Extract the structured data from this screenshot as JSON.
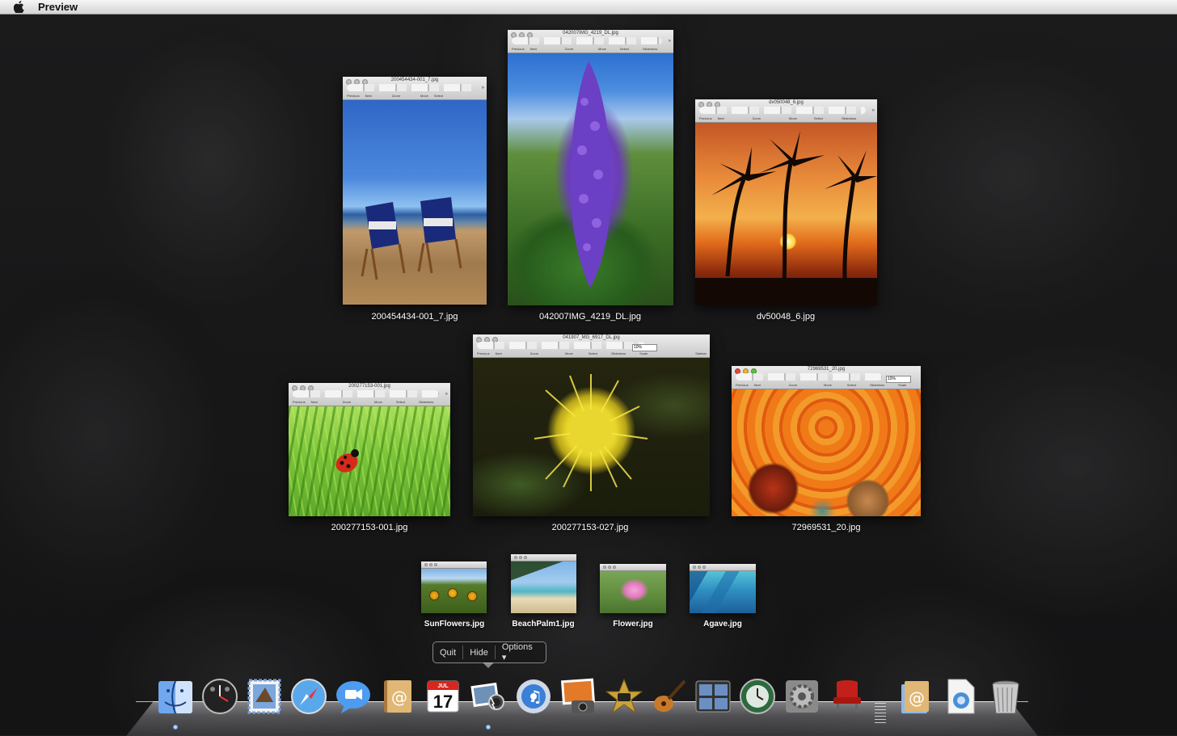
{
  "menubar": {
    "app_name": "Preview"
  },
  "windows": [
    {
      "title": "200454434-001_7.jpg",
      "caption": "200454434-001_7.jpg",
      "toolbar": [
        "Previous",
        "Next",
        "Zoom",
        "Move",
        "Select"
      ]
    },
    {
      "title": "042007IMG_4219_DL.jpg",
      "caption": "042007IMG_4219_DL.jpg",
      "toolbar": [
        "Previous",
        "Next",
        "Zoom",
        "Move",
        "Select",
        "Slideshow"
      ]
    },
    {
      "title": "dv050048_6.jpg",
      "caption": "dv50048_6.jpg",
      "toolbar": [
        "Previous",
        "Next",
        "Zoom",
        "Move",
        "Select",
        "Slideshow"
      ]
    },
    {
      "title": "200277153-001.jpg",
      "caption": "200277153-001.jpg",
      "toolbar": [
        "Previous",
        "Next",
        "Zoom",
        "Move",
        "Select",
        "Slideshow"
      ]
    },
    {
      "title": "041907_MG_6917_DL.jpg",
      "caption": "200277153-027.jpg",
      "toolbar": [
        "Previous",
        "Next",
        "Zoom",
        "Move",
        "Select",
        "Slideshow",
        "Scale",
        "Sidebar"
      ],
      "scale_value": "10%"
    },
    {
      "title": "72969531_20.jpg",
      "caption": "72969531_20.jpg",
      "toolbar": [
        "Previous",
        "Next",
        "Zoom",
        "Move",
        "Select",
        "Slideshow",
        "Scale"
      ],
      "scale_value": "10%"
    }
  ],
  "thumbnails": [
    {
      "caption": "SunFlowers.jpg"
    },
    {
      "caption": "BeachPalm1.jpg"
    },
    {
      "caption": "Flower.jpg"
    },
    {
      "caption": "Agave.jpg"
    }
  ],
  "dock_menu": {
    "items": [
      "Quit",
      "Hide",
      "Options ▾"
    ]
  },
  "dock": {
    "apps": [
      "finder-icon",
      "dashboard-icon",
      "mail-icon",
      "safari-icon",
      "ichat-icon",
      "address-book-icon",
      "ical-icon",
      "preview-icon",
      "itunes-icon",
      "iphoto-icon",
      "imovie-icon",
      "garageband-icon",
      "spaces-icon",
      "time-machine-icon",
      "system-preferences-icon",
      "front-row-icon"
    ],
    "stacks": [
      "documents-stack-icon",
      "downloads-stack-icon",
      "trash-icon"
    ],
    "ical_month": "JUL",
    "ical_day": "17"
  }
}
